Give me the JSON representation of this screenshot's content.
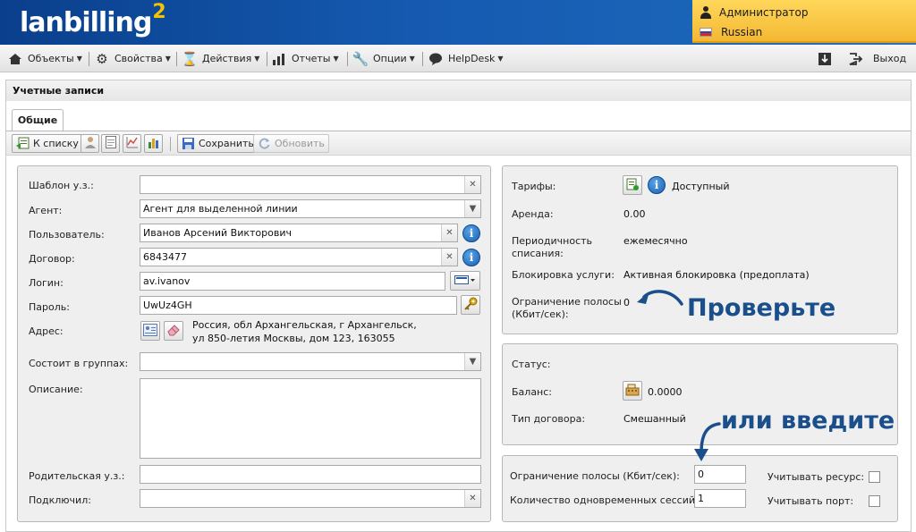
{
  "header": {
    "logo_text": "lanbilling",
    "logo_sup": "2",
    "user_name": "Администратор",
    "language": "Russian"
  },
  "menu": {
    "items": [
      {
        "label": "Объекты",
        "icon": "house-icon"
      },
      {
        "label": "Свойства",
        "icon": "gear-icon"
      },
      {
        "label": "Действия",
        "icon": "hourglass-icon"
      },
      {
        "label": "Отчеты",
        "icon": "bar-chart-icon"
      },
      {
        "label": "Опции",
        "icon": "wrench-icon"
      },
      {
        "label": "HelpDesk",
        "icon": "chat-bubble-icon"
      }
    ],
    "exit_label": "Выход"
  },
  "panel": {
    "title": "Учетные записи",
    "tab_label": "Общие"
  },
  "toolbar": {
    "back_label": "К списку",
    "save_label": "Сохранить",
    "refresh_label": "Обновить"
  },
  "form": {
    "template_label": "Шаблон у.з.:",
    "template_value": "",
    "agent_label": "Агент:",
    "agent_value": "Агент для выделенной линии",
    "user_label": "Пользователь:",
    "user_value": "Иванов Арсений Викторович",
    "contract_label": "Договор:",
    "contract_value": "6843477",
    "login_label": "Логин:",
    "login_value": "av.ivanov",
    "password_label": "Пароль:",
    "password_value": "UwUz4GH",
    "address_label": "Адрес:",
    "address_line1": "Россия, обл Архангельская, г Архангельск,",
    "address_line2": "ул 850-летия Москвы, дом 123, 163055",
    "groups_label": "Состоит в группах:",
    "groups_value": "",
    "description_label": "Описание:",
    "description_value": "",
    "parent_label": "Родительская у.з.:",
    "parent_value": "",
    "connected_label": "Подключил:",
    "connected_value": ""
  },
  "tariff_box": {
    "tariffs_label": "Тарифы:",
    "tariffs_value": "Доступный",
    "rent_label": "Аренда:",
    "rent_value": "0.00",
    "period_label_1": "Периодичность",
    "period_label_2": "списания:",
    "period_value": "ежемесячно",
    "block_label": "Блокировка услуги:",
    "block_value": "Активная блокировка (предоплата)",
    "bandwidth_label_1": "Ограничение полосы",
    "bandwidth_label_2": "(Кбит/сек):",
    "bandwidth_value": "0"
  },
  "status_box": {
    "status_label": "Статус:",
    "status_value": "",
    "balance_label": "Баланс:",
    "balance_value": "0.0000",
    "contract_type_label": "Тип договора:",
    "contract_type_value": "Смешанный"
  },
  "limits_box": {
    "bandwidth_label": "Ограничение полосы (Кбит/сек):",
    "bandwidth_value": "0",
    "sessions_label": "Количество одновременных сессий:",
    "sessions_value": "1",
    "resource_label": "Учитывать ресурс:",
    "port_label": "Учитывать порт:"
  },
  "annotations": {
    "check_text": "Проверьте",
    "or_enter_text": "или введите"
  },
  "colors": {
    "header_blue": "#155ab0",
    "user_box_yellow": "#f4b833",
    "annotation_blue": "#1a4f8c"
  }
}
